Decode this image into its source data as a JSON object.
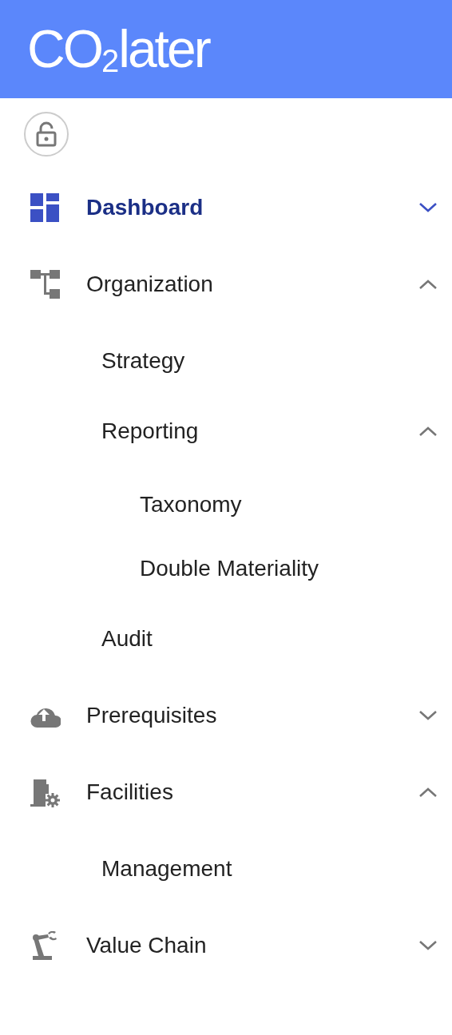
{
  "header": {
    "logo": "CO$_{2}$later"
  },
  "lock_button": {
    "locked": false
  },
  "nav": [
    {
      "label": "Dashboard",
      "selected": true,
      "expanded": false
    },
    {
      "label": "Organization",
      "selected": false,
      "expanded": true,
      "children": [
        {
          "label": "Strategy",
          "selected": false
        },
        {
          "label": "Reporting",
          "selected": false,
          "expanded": true,
          "children": [
            {
              "label": "Taxonomy",
              "selected": false
            },
            {
              "label": "Double Materiality",
              "selected": false
            }
          ]
        },
        {
          "label": "Audit",
          "selected": false
        }
      ]
    },
    {
      "label": "Prerequisites",
      "selected": false,
      "expanded": false
    },
    {
      "label": "Facilities",
      "selected": false,
      "expanded": true,
      "children": [
        {
          "label": "Management",
          "selected": false
        }
      ]
    },
    {
      "label": "Value Chain",
      "selected": false,
      "expanded": false
    }
  ]
}
